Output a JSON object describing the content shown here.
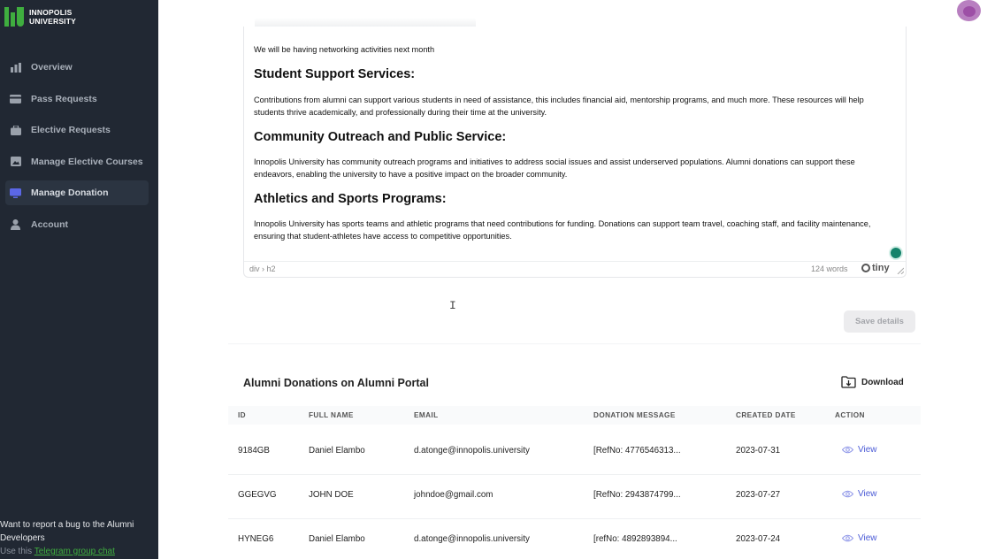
{
  "brand": {
    "name_line1": "INNOPOLIS",
    "name_line2": "UNIVERSITY",
    "color": "#3fae3f"
  },
  "sidebar": {
    "items": [
      {
        "label": "Overview",
        "icon": "bar-chart-icon"
      },
      {
        "label": "Pass Requests",
        "icon": "credit-card-icon"
      },
      {
        "label": "Elective Requests",
        "icon": "briefcase-icon"
      },
      {
        "label": "Manage Elective Courses",
        "icon": "image-icon"
      },
      {
        "label": "Manage Donation",
        "icon": "monitor-icon",
        "active": true
      },
      {
        "label": "Account",
        "icon": "user-icon"
      }
    ],
    "bug_report": {
      "text": "Want to report a bug to the Alumni Developers",
      "prefix": "Use this",
      "link": "Telegram group chat"
    }
  },
  "editor": {
    "p1": "We will be having networking activities next month",
    "h1": "Student Support Services:",
    "p2": "Contributions from alumni can support various students in need of assistance, this includes financial aid, mentorship programs, and much more. These resources will help students thrive academically, and professionally during their time at the university.",
    "h2": "Community Outreach and Public Service:",
    "p3": "Innopolis University has community outreach programs and initiatives to address social issues and assist underserved populations. Alumni donations can support these endeavors, enabling the university to have a positive impact on the broader community.",
    "h3": "Athletics and Sports Programs:",
    "p4": "Innopolis University has sports teams and athletic programs that need contributions for funding. Donations can support team travel, coaching staff, and facility maintenance, ensuring that student-athletes have access to competitive opportunities.",
    "path": "div › h2",
    "word_count": "124 words",
    "brand": "tiny"
  },
  "save_label": "Save details",
  "table": {
    "title": "Alumni Donations on Alumni Portal",
    "download_label": "Download",
    "columns": [
      "ID",
      "FULL NAME",
      "EMAIL",
      "DONATION MESSAGE",
      "CREATED DATE",
      "ACTION"
    ],
    "rows": [
      {
        "id": "9184GB",
        "name": "Daniel Elambo",
        "email": "d.atonge@innopolis.university",
        "message": "[RefNo: 4776546313...",
        "date": "2023-07-31",
        "action": "View"
      },
      {
        "id": "GGEGVG",
        "name": "JOHN DOE",
        "email": "johndoe@gmail.com",
        "message": "[RefNo: 2943874799...",
        "date": "2023-07-27",
        "action": "View"
      },
      {
        "id": "HYNEG6",
        "name": "Daniel Elambo",
        "email": "d.atonge@innopolis.university",
        "message": "[refNo: 4892893894...",
        "date": "2023-07-24",
        "action": "View"
      }
    ]
  }
}
